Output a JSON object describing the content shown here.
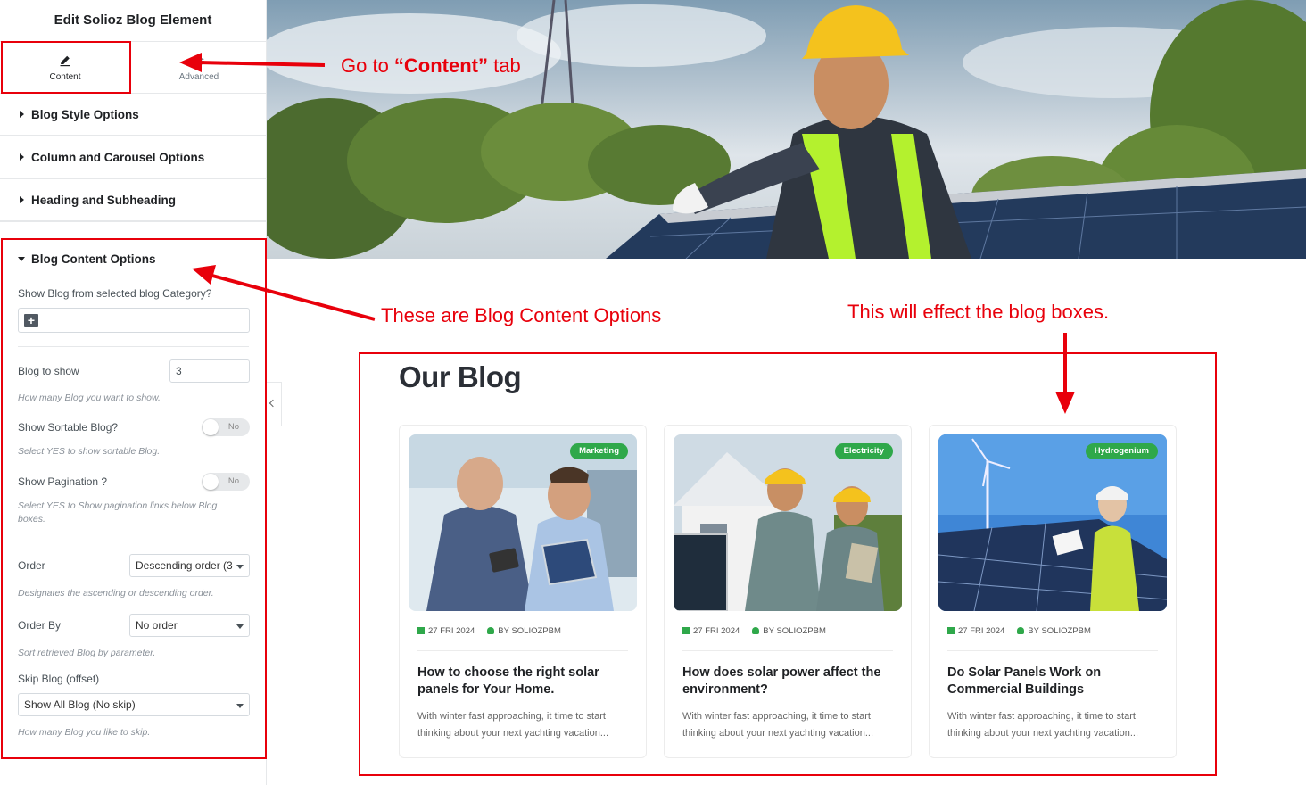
{
  "panel": {
    "title": "Edit Solioz Blog Element",
    "tabs": [
      {
        "label": "Content",
        "icon": "pencil-icon"
      },
      {
        "label": "Advanced",
        "icon": "gear-icon"
      }
    ],
    "sections": [
      {
        "label": "Blog Style Options"
      },
      {
        "label": "Column and Carousel Options"
      },
      {
        "label": "Heading and Subheading"
      }
    ],
    "open_section": {
      "label": "Blog Content Options",
      "category_label": "Show Blog from selected blog Category?",
      "blog_to_show_label": "Blog to show",
      "blog_to_show_value": "3",
      "blog_to_show_help": "How many Blog you want to show.",
      "sortable_label": "Show Sortable Blog?",
      "sortable_value": "No",
      "sortable_help": "Select YES to show sortable Blog.",
      "pagination_label": "Show Pagination ?",
      "pagination_value": "No",
      "pagination_help": "Select YES to Show pagination links below Blog boxes.",
      "order_label": "Order",
      "order_value": "Descending order (3",
      "order_help": "Designates the ascending or descending order.",
      "orderby_label": "Order By",
      "orderby_value": "No order",
      "orderby_help": "Sort retrieved Blog by parameter.",
      "skip_label": "Skip Blog (offset)",
      "skip_value": "Show All Blog (No skip)",
      "skip_help": "How many Blog you like to skip."
    }
  },
  "blog": {
    "heading": "Our Blog",
    "cards": [
      {
        "badge": "Marketing",
        "date": "27 FRI 2024",
        "author": "BY SOLIOZPBM",
        "title": "How to choose the right solar panels for Your Home.",
        "excerpt": "With winter fast approaching, it time to start thinking about your next yachting vacation..."
      },
      {
        "badge": "Electricity",
        "date": "27 FRI 2024",
        "author": "BY SOLIOZPBM",
        "title": "How does solar power affect the environment?",
        "excerpt": "With winter fast approaching, it time to start thinking about your next yachting vacation..."
      },
      {
        "badge": "Hydrogenium",
        "date": "27 FRI 2024",
        "author": "BY SOLIOZPBM",
        "title": "Do Solar Panels Work on Commercial Buildings",
        "excerpt": "With winter fast approaching, it time to start thinking about your next yachting vacation..."
      }
    ]
  },
  "annotations": {
    "content_tab_pre": "Go  to ",
    "content_tab_bold": "“Content”",
    "content_tab_post": " tab",
    "options": "These are Blog Content Options",
    "effect": "This will effect the blog boxes."
  },
  "colors": {
    "annotation_red": "#e8000b",
    "badge_green": "#2fa84a",
    "panel_border": "#e6e8ea"
  }
}
